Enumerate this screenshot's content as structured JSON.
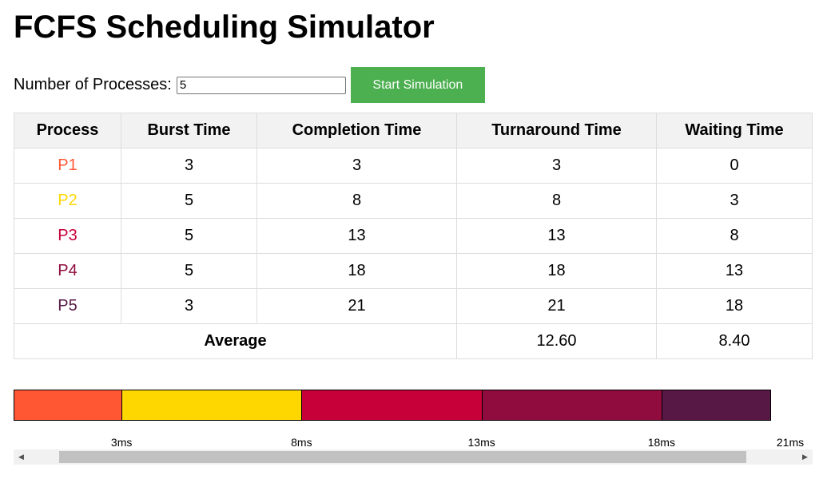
{
  "title": "FCFS Scheduling Simulator",
  "controls": {
    "label": "Number of Processes:",
    "input_value": "5",
    "button_label": "Start Simulation"
  },
  "table": {
    "headers": [
      "Process",
      "Burst Time",
      "Completion Time",
      "Turnaround Time",
      "Waiting Time"
    ],
    "rows": [
      {
        "process": "P1",
        "color": "#ff5733",
        "burst": "3",
        "completion": "3",
        "turnaround": "3",
        "waiting": "0"
      },
      {
        "process": "P2",
        "color": "#ffd700",
        "burst": "5",
        "completion": "8",
        "turnaround": "8",
        "waiting": "3"
      },
      {
        "process": "P3",
        "color": "#c70039",
        "burst": "5",
        "completion": "13",
        "turnaround": "13",
        "waiting": "8"
      },
      {
        "process": "P4",
        "color": "#900c3f",
        "burst": "5",
        "completion": "18",
        "turnaround": "18",
        "waiting": "13"
      },
      {
        "process": "P5",
        "color": "#581845",
        "burst": "3",
        "completion": "21",
        "turnaround": "21",
        "waiting": "18"
      }
    ],
    "average": {
      "label": "Average",
      "turnaround": "12.60",
      "waiting": "8.40"
    }
  },
  "gantt": {
    "total": 21,
    "segments": [
      {
        "process": "P1",
        "start": 0,
        "end": 3,
        "color": "#ff5733"
      },
      {
        "process": "P2",
        "start": 3,
        "end": 8,
        "color": "#ffd700"
      },
      {
        "process": "P3",
        "start": 8,
        "end": 13,
        "color": "#c70039"
      },
      {
        "process": "P4",
        "start": 13,
        "end": 18,
        "color": "#900c3f"
      },
      {
        "process": "P5",
        "start": 18,
        "end": 21,
        "color": "#581845"
      }
    ],
    "ticks": [
      "3ms",
      "8ms",
      "13ms",
      "18ms",
      "21ms"
    ]
  },
  "scrollbar": {
    "left_icon": "arrow-left-icon",
    "right_icon": "arrow-right-icon"
  }
}
